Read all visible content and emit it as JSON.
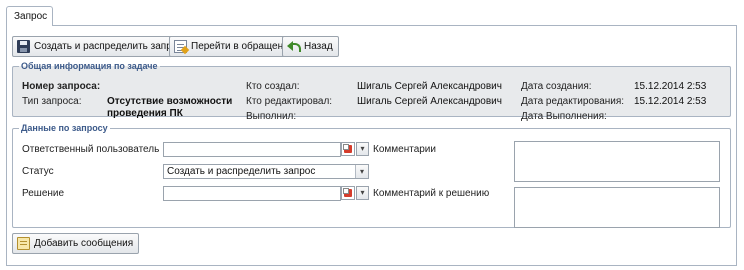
{
  "tabs": [
    {
      "label": "Запрос"
    }
  ],
  "toolbar": {
    "create_label": "Создать и распределить запрос",
    "goto_label": "Перейти в обращение",
    "back_label": "Назад"
  },
  "general": {
    "legend": "Общая информация по задаче",
    "request_number_label": "Номер запроса:",
    "request_type_label": "Тип запроса:",
    "request_type_value_line1": "Отсутствие возможности",
    "request_type_value_line2": "проведения ПК",
    "created_by_label": "Кто создал:",
    "created_by_value": "Шигаль Сергей Александрович",
    "edited_by_label": "Кто редактировал:",
    "edited_by_value": "Шигаль Сергей Александрович",
    "performed_label": "Выполнил:",
    "created_date_label": "Дата создания:",
    "created_date_value": "15.12.2014 2:53",
    "edited_date_label": "Дата редактирования:",
    "edited_date_value": "15.12.2014 2:53",
    "done_date_label": "Дата Выполнения:"
  },
  "request_data": {
    "legend": "Данные по запросу",
    "responsible_label": "Ответственный пользователь",
    "responsible_value": "",
    "comments_label": "Комментарии",
    "status_label": "Статус",
    "status_value": "Создать и распределить запрос",
    "decision_label": "Решение",
    "decision_value": "",
    "decision_comment_label": "Комментарий к решению"
  },
  "footer": {
    "add_message_label": "Добавить сообщения"
  }
}
